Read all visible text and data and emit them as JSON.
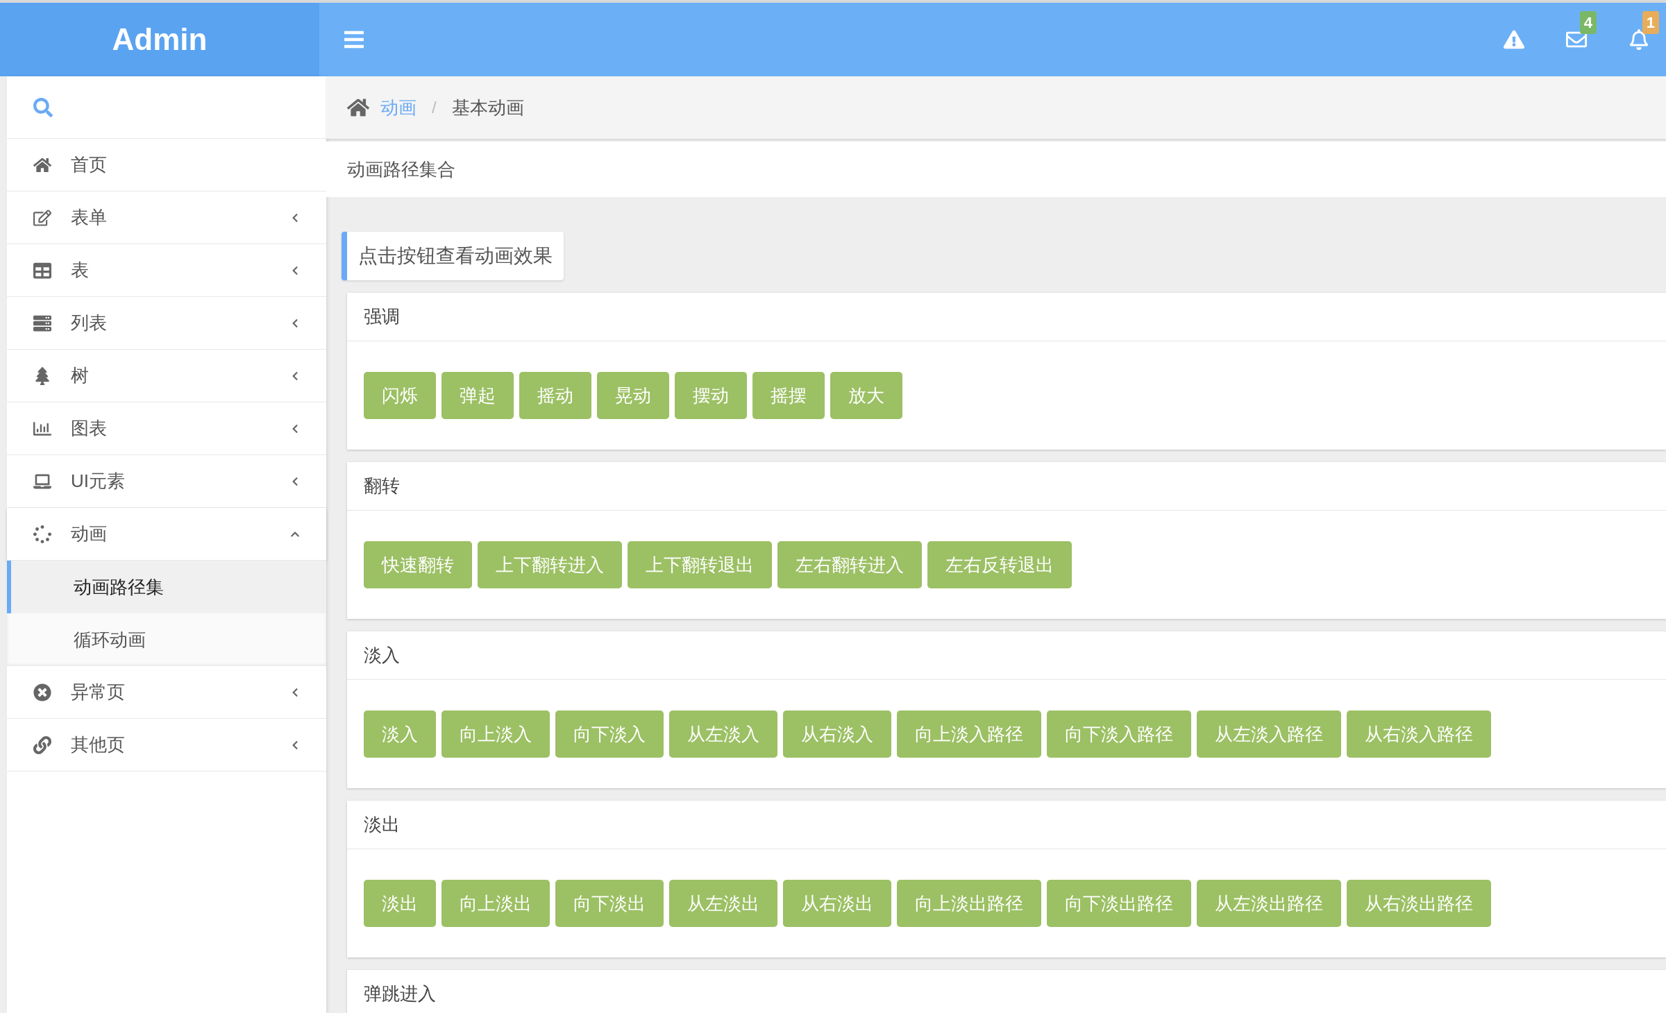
{
  "header": {
    "logo": "Admin",
    "icons": [
      {
        "kind": "warning"
      },
      {
        "kind": "mail",
        "badge": "4"
      },
      {
        "kind": "bell",
        "badge": "1"
      }
    ]
  },
  "sidebar": {
    "items": [
      {
        "kind": "link",
        "label": "首页"
      },
      {
        "kind": "submenu",
        "label": "表单",
        "expanded": false
      },
      {
        "kind": "submenu",
        "label": "表",
        "expanded": false
      },
      {
        "kind": "submenu",
        "label": "列表",
        "expanded": false
      },
      {
        "kind": "submenu",
        "label": "树",
        "expanded": false
      },
      {
        "kind": "submenu",
        "label": "图表",
        "expanded": false
      },
      {
        "kind": "submenu",
        "label": "UI元素",
        "expanded": false
      },
      {
        "kind": "submenu",
        "label": "动画",
        "expanded": true,
        "children": [
          {
            "label": "动画路径集",
            "selected": true
          },
          {
            "label": "循环动画",
            "selected": false
          }
        ]
      },
      {
        "kind": "submenu",
        "label": "异常页",
        "expanded": false
      },
      {
        "kind": "submenu",
        "label": "其他页",
        "expanded": false
      }
    ]
  },
  "breadcrumb": {
    "items": [
      "动画",
      "基本动画"
    ],
    "separator": "/"
  },
  "page_title": "动画路径集合",
  "callout": "点击按钮查看动画效果",
  "panels": [
    {
      "title": "强调",
      "buttons": [
        "闪烁",
        "弹起",
        "摇动",
        "晃动",
        "摆动",
        "摇摆",
        "放大"
      ]
    },
    {
      "title": "翻转",
      "buttons": [
        "快速翻转",
        "上下翻转进入",
        "上下翻转退出",
        "左右翻转进入",
        "左右反转退出"
      ]
    },
    {
      "title": "淡入",
      "buttons": [
        "淡入",
        "向上淡入",
        "向下淡入",
        "从左淡入",
        "从右淡入",
        "向上淡入路径",
        "向下淡入路径",
        "从左淡入路径",
        "从右淡入路径"
      ]
    },
    {
      "title": "淡出",
      "buttons": [
        "淡出",
        "向上淡出",
        "向下淡出",
        "从左淡出",
        "从右淡出",
        "向上淡出路径",
        "向下淡出路径",
        "从左淡出路径",
        "从右淡出路径"
      ]
    },
    {
      "title": "弹跳进入"
    }
  ]
}
